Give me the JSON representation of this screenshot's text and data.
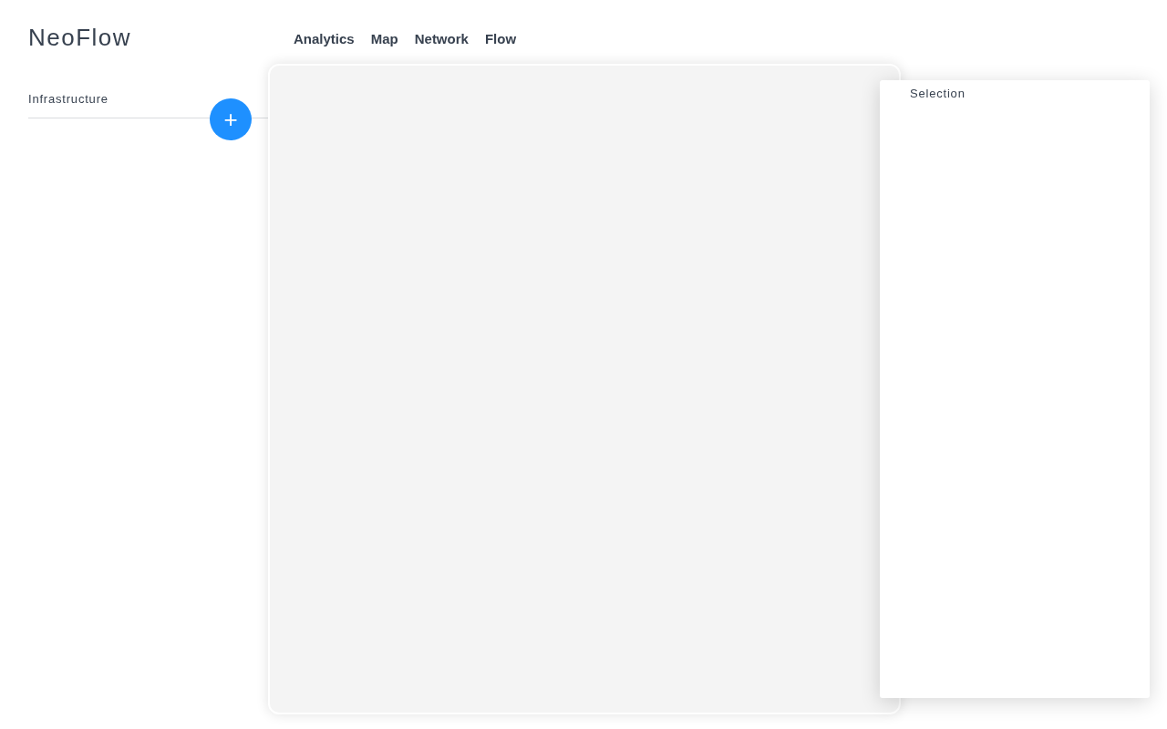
{
  "logo": "NeoFlow",
  "nav": [
    {
      "label": "Analytics"
    },
    {
      "label": "Map"
    },
    {
      "label": "Network"
    },
    {
      "label": "Flow"
    }
  ],
  "sidebar": {
    "section": "Infrastructure",
    "add_button": "+"
  },
  "selection_panel": {
    "title": "Selection"
  }
}
